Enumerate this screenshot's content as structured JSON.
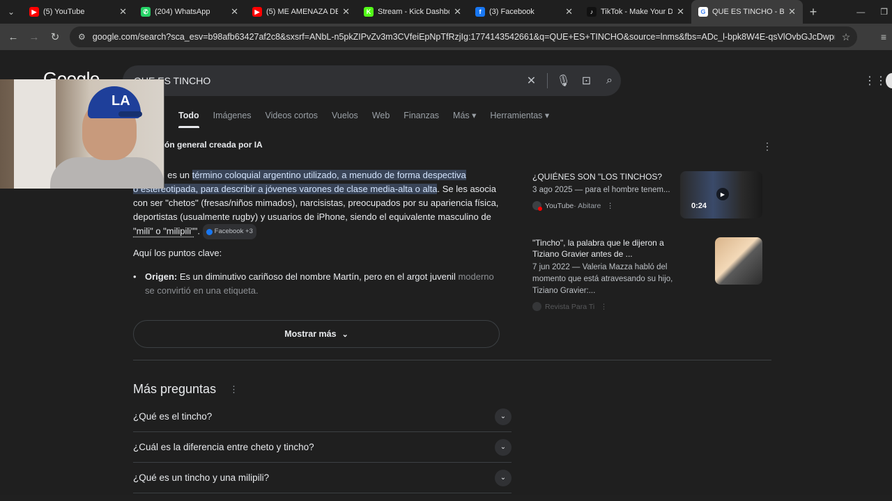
{
  "browser": {
    "tabs": [
      {
        "title": "(5) YouTube",
        "favicon": "youtube-icon",
        "color": "#ff0000",
        "glyph": "▶"
      },
      {
        "title": "(204) WhatsApp",
        "favicon": "whatsapp-icon",
        "color": "#25d366",
        "glyph": "✆"
      },
      {
        "title": "(5) ME AMENAZA DE M",
        "favicon": "youtube-icon",
        "color": "#ff0000",
        "glyph": "▶"
      },
      {
        "title": "Stream - Kick Dashboar",
        "favicon": "kick-icon",
        "color": "#53fc18",
        "glyph": "K"
      },
      {
        "title": "(3) Facebook",
        "favicon": "facebook-icon",
        "color": "#1877f2",
        "glyph": "f"
      },
      {
        "title": "TikTok - Make Your Da",
        "favicon": "tiktok-icon",
        "color": "#111111",
        "glyph": "♪"
      },
      {
        "title": "QUE ES TINCHO - Busc",
        "favicon": "google-icon",
        "color": "#ffffff",
        "glyph": "G"
      }
    ],
    "url": "google.com/search?sca_esv=b98afb63427af2c8&sxsrf=ANbL-n5pkZIPvZv3m3CVfeiEpNpTfRzjIg:1774143542661&q=QUE+ES+TINCHO&source=lnms&fbs=ADc_l-bpk8W4E-qsVlOvbGJcDwpn60DczFdcvPnu..."
  },
  "google": {
    "logo": "Google",
    "query": "QUE ES TINCHO",
    "tabs": [
      "Todo",
      "Imágenes",
      "Videos cortos",
      "Vuelos",
      "Web",
      "Finanzas",
      "Más ▾",
      "Herramientas ▾"
    ],
    "ai": {
      "heading": "ón general creada por IA",
      "p1_start": "\" es un ",
      "p1_hl1": "término coloquial argentino utilizado, a menudo de forma despectiva",
      "p1_hl2": "o estereotipada, para describir a jóvenes varones de clase media-alta o alta",
      "p1_rest": ". Se les asocia con ser \"chetos\" (fresas/niños mimados), narcisistas, preocupados por su apariencia física, deportistas (usualmente rugby) y usuarios de iPhone, siendo el equivalente masculino de ",
      "p1_quote": "\"mili\" o \"milipili\"",
      "p1_end": "\".",
      "source_chip": "Facebook +3",
      "intro": "Aquí los puntos clave:",
      "bullet_label": "Origen:",
      "bullet_text": " Es un diminutivo cariñoso del nombre Martín, pero en el argot juvenil ",
      "bullet_faded": "moderno se convirtió en una etiqueta.",
      "show_more": "Mostrar más"
    },
    "side_results": [
      {
        "title": "¿QUIÉNES SON \"LOS TINCHOS?",
        "meta": "3 ago 2025 — para el hombre tenem...",
        "source": "YouTube",
        "source_sub": " · Abitare",
        "duration": "0:24"
      },
      {
        "title": "\"Tincho\", la palabra que le dijeron a Tiziano Gravier antes de ...",
        "meta": "7 jun 2022 — Valeria Mazza habló del momento que está atravesando su hijo, Tiziano Gravier:...",
        "source": "Revista Para Ti"
      }
    ],
    "more_questions": {
      "title": "Más preguntas",
      "items": [
        "¿Qué es el tincho?",
        "¿Cuál es la diferencia entre cheto y tincho?",
        "¿Qué es un tincho y una milipili?"
      ]
    }
  }
}
